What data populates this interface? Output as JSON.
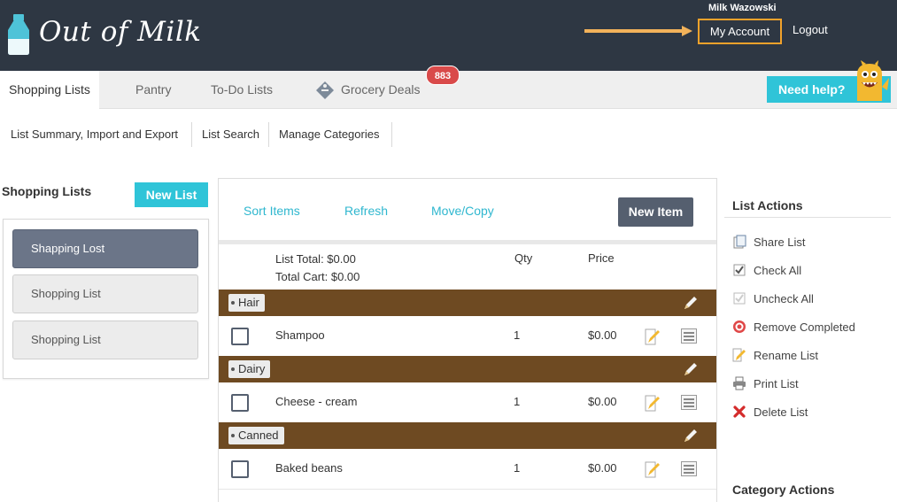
{
  "header": {
    "logo_text": "Out of Milk",
    "user_name": "Milk Wazowski",
    "my_account_label": "My Account",
    "logout_label": "Logout"
  },
  "tabs": [
    {
      "label": "Shopping Lists",
      "active": true
    },
    {
      "label": "Pantry"
    },
    {
      "label": "To-Do Lists"
    },
    {
      "label": "Grocery Deals",
      "badge": "883"
    }
  ],
  "help_label": "Need help?",
  "subnav": [
    "List Summary, Import and Export",
    "List Search",
    "Manage Categories"
  ],
  "sidebar": {
    "heading": "Shopping Lists",
    "new_list_label": "New List",
    "lists": [
      "Shapping Lost",
      "Shopping List",
      "Shopping List"
    ]
  },
  "toolbar": {
    "sort_label": "Sort Items",
    "refresh_label": "Refresh",
    "move_copy_label": "Move/Copy",
    "new_item_label": "New Item"
  },
  "summary": {
    "list_total": "List Total: $0.00",
    "total_cart": "Total Cart: $0.00",
    "qty_header": "Qty",
    "price_header": "Price"
  },
  "categories": [
    {
      "name": "Hair",
      "items": [
        {
          "name": "Shampoo",
          "qty": "1",
          "price": "$0.00"
        }
      ]
    },
    {
      "name": "Dairy",
      "items": [
        {
          "name": "Cheese - cream",
          "qty": "1",
          "price": "$0.00"
        }
      ]
    },
    {
      "name": "Canned",
      "items": [
        {
          "name": "Baked beans",
          "qty": "1",
          "price": "$0.00"
        }
      ]
    }
  ],
  "list_actions": {
    "heading": "List Actions",
    "items": [
      {
        "label": "Share List",
        "icon": "share-icon"
      },
      {
        "label": "Check All",
        "icon": "checked-box-icon"
      },
      {
        "label": "Uncheck All",
        "icon": "unchecked-box-icon"
      },
      {
        "label": "Remove Completed",
        "icon": "target-icon"
      },
      {
        "label": "Rename List",
        "icon": "pencil-page-icon"
      },
      {
        "label": "Print List",
        "icon": "printer-icon"
      },
      {
        "label": "Delete List",
        "icon": "red-x-icon"
      }
    ]
  },
  "category_actions_heading": "Category Actions",
  "colors": {
    "header_bg": "#2e3743",
    "accent_cyan": "#2fc4d8",
    "category_brown": "#6e4a22",
    "highlight_orange": "#f2a22b",
    "badge_red": "#d94a4a",
    "selected_list": "#6b7588"
  }
}
